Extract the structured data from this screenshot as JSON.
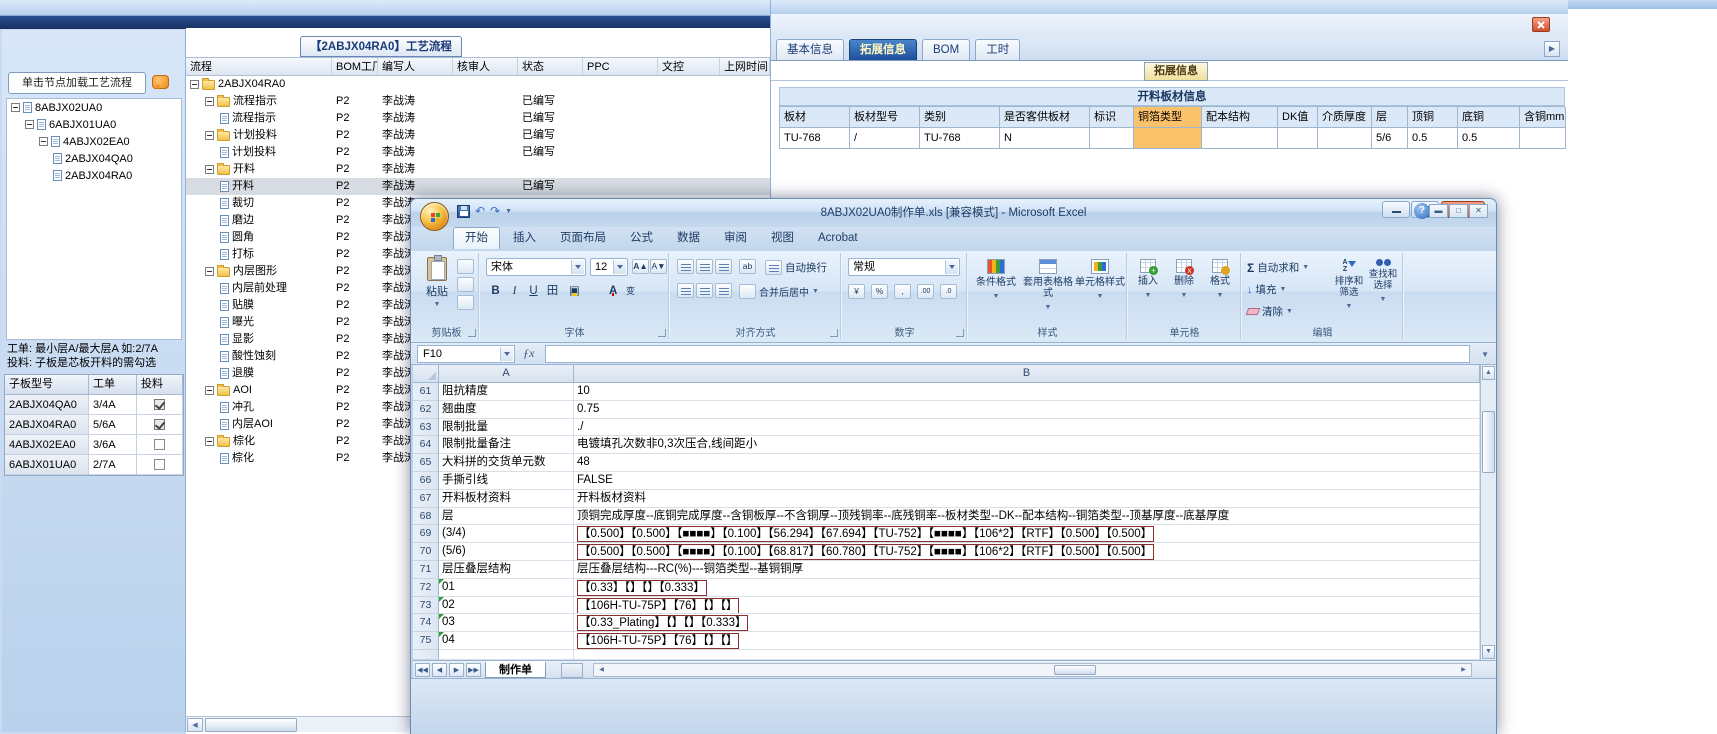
{
  "colors": {
    "active_tab_bg": "#1d4e9b",
    "active_tab_text": "#fff8c0",
    "copper_highlight": "#fbc26b",
    "selected_row": "#d7dce2",
    "close_red": "#d04f2e"
  },
  "left_panel": {
    "hint": "单击节点加载工艺流程",
    "tree": [
      {
        "label": "8ABJX02UA0",
        "level": 0,
        "expand": true
      },
      {
        "label": "6ABJX01UA0",
        "level": 1,
        "expand": true
      },
      {
        "label": "4ABJX02EA0",
        "level": 2,
        "expand": true
      },
      {
        "label": "2ABJX04QA0",
        "level": 3,
        "expand": false
      },
      {
        "label": "2ABJX04RA0",
        "level": 3,
        "expand": false
      }
    ],
    "note_line1": "工单: 最小层A/最大层A 如:2/7A",
    "note_line2": "投料: 子板是芯板开料的需勾选",
    "board_table": {
      "headers": [
        "子板型号",
        "工单",
        "投料"
      ],
      "rows": [
        {
          "model": "2ABJX04QA0",
          "order": "3/4A",
          "checked": true
        },
        {
          "model": "2ABJX04RA0",
          "order": "5/6A",
          "checked": true
        },
        {
          "model": "4ABJX02EA0",
          "order": "3/6A",
          "checked": false
        },
        {
          "model": "6ABJX01UA0",
          "order": "2/7A",
          "checked": false
        }
      ]
    }
  },
  "flow_panel": {
    "title": "【2ABJX04RA0】工艺流程",
    "headers": [
      "流程",
      "BOM工厂",
      "编写人",
      "核审人",
      "状态",
      "PPC",
      "文控",
      "上网时间"
    ],
    "rows": [
      {
        "label": "2ABJX04RA0",
        "type": "root",
        "level": 0,
        "bom": "",
        "writer": "",
        "status": ""
      },
      {
        "label": "流程指示",
        "type": "folder",
        "level": 1,
        "bom": "P2",
        "writer": "李战涛",
        "status": "已编写"
      },
      {
        "label": "流程指示",
        "type": "doc",
        "level": 2,
        "bom": "P2",
        "writer": "李战涛",
        "status": "已编写"
      },
      {
        "label": "计划投料",
        "type": "folder",
        "level": 1,
        "bom": "P2",
        "writer": "李战涛",
        "status": "已编写"
      },
      {
        "label": "计划投料",
        "type": "doc",
        "level": 2,
        "bom": "P2",
        "writer": "李战涛",
        "status": "已编写"
      },
      {
        "label": "开料",
        "type": "folder",
        "level": 1,
        "bom": "P2",
        "writer": "李战涛",
        "status": ""
      },
      {
        "label": "开料",
        "type": "doc",
        "level": 2,
        "bom": "P2",
        "writer": "李战涛",
        "status": "已编写",
        "selected": true
      },
      {
        "label": "裁切",
        "type": "doc",
        "level": 2,
        "bom": "P2",
        "writer": "李战涛",
        "status": ""
      },
      {
        "label": "磨边",
        "type": "doc",
        "level": 2,
        "bom": "P2",
        "writer": "李战涛",
        "status": ""
      },
      {
        "label": "圆角",
        "type": "doc",
        "level": 2,
        "bom": "P2",
        "writer": "李战涛",
        "status": ""
      },
      {
        "label": "打标",
        "type": "doc",
        "level": 2,
        "bom": "P2",
        "writer": "李战涛",
        "status": ""
      },
      {
        "label": "内层图形",
        "type": "folder",
        "level": 1,
        "bom": "P2",
        "writer": "李战涛",
        "status": ""
      },
      {
        "label": "内层前处理",
        "type": "doc",
        "level": 2,
        "bom": "P2",
        "writer": "李战涛",
        "status": ""
      },
      {
        "label": "贴膜",
        "type": "doc",
        "level": 2,
        "bom": "P2",
        "writer": "李战涛",
        "status": ""
      },
      {
        "label": "曝光",
        "type": "doc",
        "level": 2,
        "bom": "P2",
        "writer": "李战涛",
        "status": ""
      },
      {
        "label": "显影",
        "type": "doc",
        "level": 2,
        "bom": "P2",
        "writer": "李战涛",
        "status": ""
      },
      {
        "label": "酸性蚀刻",
        "type": "doc",
        "level": 2,
        "bom": "P2",
        "writer": "李战涛",
        "status": ""
      },
      {
        "label": "退膜",
        "type": "doc",
        "level": 2,
        "bom": "P2",
        "writer": "李战涛",
        "status": ""
      },
      {
        "label": "AOI",
        "type": "folder",
        "level": 1,
        "bom": "P2",
        "writer": "李战涛",
        "status": ""
      },
      {
        "label": "冲孔",
        "type": "doc",
        "level": 2,
        "bom": "P2",
        "writer": "李战涛",
        "status": ""
      },
      {
        "label": "内层AOI",
        "type": "doc",
        "level": 2,
        "bom": "P2",
        "writer": "李战涛",
        "status": ""
      },
      {
        "label": "棕化",
        "type": "folder",
        "level": 1,
        "bom": "P2",
        "writer": "李战涛",
        "status": ""
      },
      {
        "label": "棕化",
        "type": "doc",
        "level": 2,
        "bom": "P2",
        "writer": "李战涛",
        "status": ""
      }
    ]
  },
  "info_panel": {
    "tabs": [
      "基本信息",
      "拓展信息",
      "BOM",
      "工时"
    ],
    "active_tab": "拓展信息",
    "sub_tab_label": "拓展信息",
    "section_title": "开料板材信息",
    "table": {
      "headers": [
        "板材",
        "板材型号",
        "类别",
        "是否客供板材",
        "标识",
        "铜箔类型",
        "配本结构",
        "DK值",
        "介质厚度",
        "层",
        "顶铜",
        "底铜",
        "含铜mm"
      ],
      "highlight_col": 5,
      "row": [
        "TU-768",
        "/",
        "TU-768",
        "N",
        "",
        "",
        "",
        "",
        "",
        "5/6",
        "0.5",
        "0.5",
        ""
      ]
    }
  },
  "excel": {
    "title": "8ABJX02UA0制作单.xls [兼容模式] - Microsoft Excel",
    "ribbon_tabs": [
      "开始",
      "插入",
      "页面布局",
      "公式",
      "数据",
      "审阅",
      "视图",
      "Acrobat"
    ],
    "active_ribbon_tab": "开始",
    "clipboard": {
      "label": "剪贴板",
      "paste": "粘贴"
    },
    "font_group": {
      "label": "字体",
      "font_name": "宋体",
      "font_size": "12"
    },
    "align_group": {
      "label": "对齐方式",
      "wrap": "自动换行",
      "merge": "合并后居中"
    },
    "number_group": {
      "label": "数字",
      "format": "常规"
    },
    "style_group": {
      "label": "样式",
      "buttons": [
        "条件格式",
        "套用表格格式",
        "单元格样式"
      ]
    },
    "cells_group": {
      "label": "单元格",
      "buttons": [
        "插入",
        "删除",
        "格式"
      ]
    },
    "edit_group": {
      "label": "编辑",
      "sum": "自动求和",
      "fill": "填充",
      "clear": "清除",
      "sort": "排序和筛选",
      "find": "查找和选择"
    },
    "name_box": "F10",
    "columns": [
      "A",
      "B"
    ],
    "rows": [
      {
        "n": "61",
        "a": "阻抗精度",
        "b": "10"
      },
      {
        "n": "62",
        "a": "翘曲度",
        "b": "0.75"
      },
      {
        "n": "63",
        "a": "限制批量",
        "b": "./"
      },
      {
        "n": "64",
        "a": "限制批量备注",
        "b": "电镀填孔次数非0,3次压合,线间距小"
      },
      {
        "n": "65",
        "a": "大料拼的交货单元数",
        "b": "48"
      },
      {
        "n": "66",
        "a": "手撕引线",
        "b": "FALSE"
      },
      {
        "n": "67",
        "a": "开料板材资料",
        "b": "开料板材资料"
      },
      {
        "n": "68",
        "a": "层",
        "b": "顶铜完成厚度--底铜完成厚度--含铜板厚--不含铜厚--顶残铜率--底残铜率--板材类型--DK--配本结构--铜箔类型--顶基厚度--底基厚度"
      },
      {
        "n": "69",
        "a": "(3/4)",
        "b": "【0.500】【0.500】【■■■■】【0.100】【56.294】【67.694】【TU-752】【■■■■】【106*2】【RTF】【0.500】【0.500】",
        "boxed": true
      },
      {
        "n": "70",
        "a": "(5/6)",
        "b": "【0.500】【0.500】【■■■■】【0.100】【68.817】【60.780】【TU-752】【■■■■】【106*2】【RTF】【0.500】【0.500】",
        "boxed": true
      },
      {
        "n": "71",
        "a": "层压叠层结构",
        "b": "层压叠层结构---RC(%)---铜箔类型--基铜铜厚"
      },
      {
        "n": "72",
        "a": "01",
        "b": "【0.33】【】【】【0.333】",
        "boxed": true,
        "flag": true
      },
      {
        "n": "73",
        "a": "02",
        "b": "【106H-TU-75P】【76】【】【】",
        "boxed": true,
        "flag": true
      },
      {
        "n": "74",
        "a": "03",
        "b": "【0.33_Plating】【】【】【0.333】",
        "boxed": true,
        "flag": true
      },
      {
        "n": "75",
        "a": "04",
        "b": "【106H-TU-75P】【76】【】【】",
        "boxed": true,
        "flag": true
      }
    ],
    "sheet_tab": "制作单"
  }
}
